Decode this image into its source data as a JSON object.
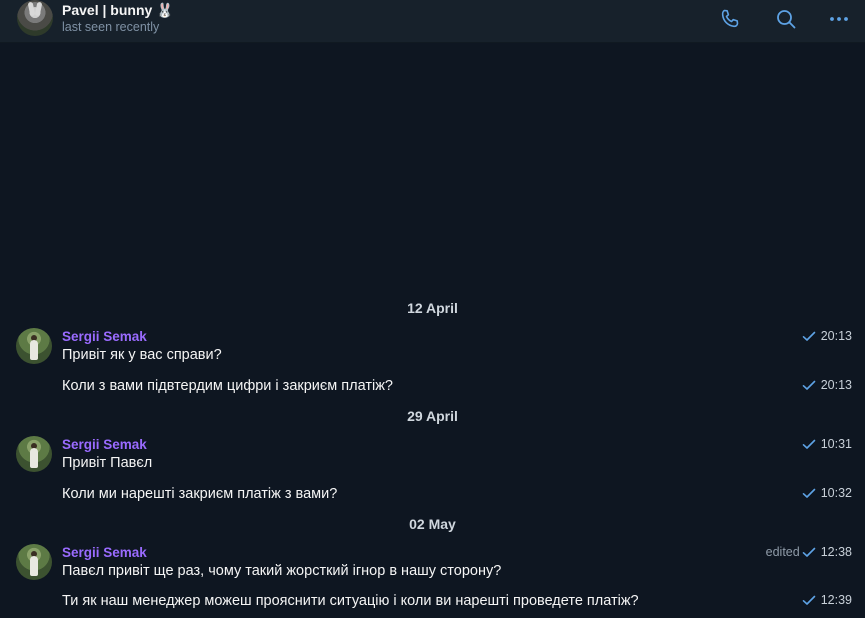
{
  "header": {
    "name": "Pavel | bunny",
    "name_emoji": "🐰",
    "status": "last seen recently",
    "icons": [
      "phone-icon",
      "search-icon",
      "more-icon"
    ]
  },
  "colors": {
    "background": "#0e1621",
    "header_bg": "#17212b",
    "sender": "#9a6bff",
    "accent": "#5ea3e6"
  },
  "chat": {
    "dates": [
      "12 April",
      "29 April",
      "02 May"
    ],
    "groups": [
      {
        "sender": "Sergii Semak",
        "messages": [
          {
            "text": "Привіт як у вас справи?",
            "time": "20:13",
            "edited": ""
          },
          {
            "text": "Коли з вами підвтердим цифри і закриєм платіж?",
            "time": "20:13",
            "edited": ""
          }
        ]
      },
      {
        "sender": "Sergii Semak",
        "messages": [
          {
            "text": "Привіт Павєл",
            "time": "10:31",
            "edited": ""
          },
          {
            "text": "Коли ми нарешті закриєм платіж з вами?",
            "time": "10:32",
            "edited": ""
          }
        ]
      },
      {
        "sender": "Sergii Semak",
        "messages": [
          {
            "text": "Павєл привіт ще раз, чому такий жорсткий ігнор в нашу сторону?",
            "time": "12:38",
            "edited": "edited"
          },
          {
            "text": "Ти як наш менеджер можеш прояснити ситуацію і коли ви нарешті проведете платіж?",
            "time": "12:39",
            "edited": ""
          }
        ]
      }
    ]
  }
}
